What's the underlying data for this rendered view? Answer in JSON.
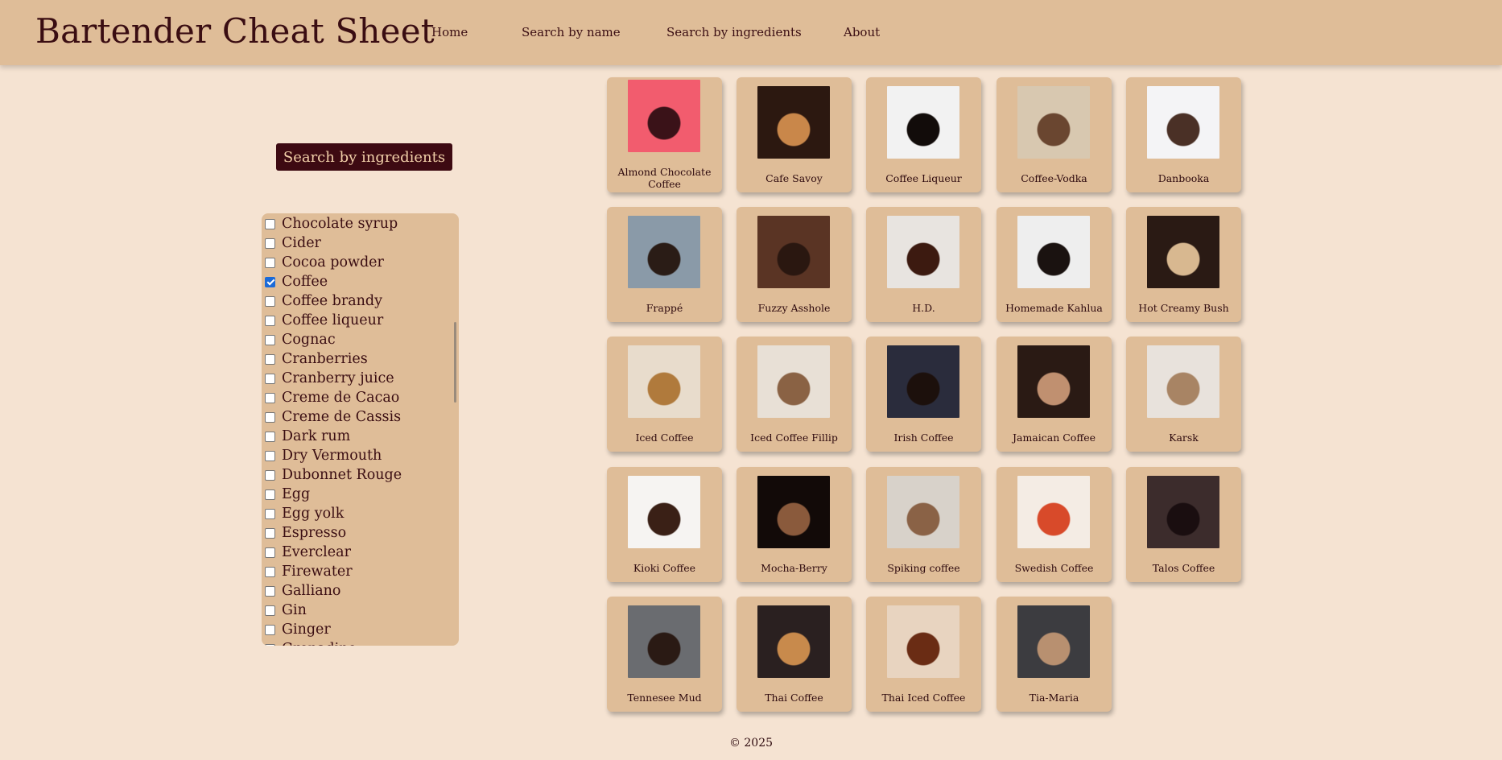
{
  "header": {
    "title": "Bartender Cheat Sheet",
    "nav": [
      "Home",
      "Search by name",
      "Search by ingredients",
      "About"
    ]
  },
  "search": {
    "button_label": "Search by ingredients"
  },
  "ingredients": [
    {
      "label": "Chocolate syrup",
      "checked": false
    },
    {
      "label": "Cider",
      "checked": false
    },
    {
      "label": "Cocoa powder",
      "checked": false
    },
    {
      "label": "Coffee",
      "checked": true
    },
    {
      "label": "Coffee brandy",
      "checked": false
    },
    {
      "label": "Coffee liqueur",
      "checked": false
    },
    {
      "label": "Cognac",
      "checked": false
    },
    {
      "label": "Cranberries",
      "checked": false
    },
    {
      "label": "Cranberry juice",
      "checked": false
    },
    {
      "label": "Creme de Cacao",
      "checked": false
    },
    {
      "label": "Creme de Cassis",
      "checked": false
    },
    {
      "label": "Dark rum",
      "checked": false
    },
    {
      "label": "Dry Vermouth",
      "checked": false
    },
    {
      "label": "Dubonnet Rouge",
      "checked": false
    },
    {
      "label": "Egg",
      "checked": false
    },
    {
      "label": "Egg yolk",
      "checked": false
    },
    {
      "label": "Espresso",
      "checked": false
    },
    {
      "label": "Everclear",
      "checked": false
    },
    {
      "label": "Firewater",
      "checked": false
    },
    {
      "label": "Galliano",
      "checked": false
    },
    {
      "label": "Gin",
      "checked": false
    },
    {
      "label": "Ginger",
      "checked": false
    },
    {
      "label": "Grenadine",
      "checked": false
    }
  ],
  "drinks": [
    {
      "name": "Almond Chocolate Coffee",
      "colors": [
        "#f25c6e",
        "#3a1218"
      ]
    },
    {
      "name": "Cafe Savoy",
      "colors": [
        "#2c1810",
        "#c9874a"
      ]
    },
    {
      "name": "Coffee Liqueur",
      "colors": [
        "#f2f2f2",
        "#120c0a"
      ]
    },
    {
      "name": "Coffee-Vodka",
      "colors": [
        "#d8c8b0",
        "#6a4630"
      ]
    },
    {
      "name": "Danbooka",
      "colors": [
        "#f4f4f6",
        "#4a3026"
      ]
    },
    {
      "name": "Frappé",
      "colors": [
        "#8a9aa8",
        "#2a1c16"
      ]
    },
    {
      "name": "Fuzzy Asshole",
      "colors": [
        "#5a3424",
        "#2a1710"
      ]
    },
    {
      "name": "H.D.",
      "colors": [
        "#e8e4e0",
        "#3c1a10"
      ]
    },
    {
      "name": "Homemade Kahlua",
      "colors": [
        "#eeeeee",
        "#1a1210"
      ]
    },
    {
      "name": "Hot Creamy Bush",
      "colors": [
        "#2a1a14",
        "#d8b890"
      ]
    },
    {
      "name": "Iced Coffee",
      "colors": [
        "#e8dccc",
        "#b07a3c"
      ]
    },
    {
      "name": "Iced Coffee Fillip",
      "colors": [
        "#e8e0d6",
        "#8a6244"
      ]
    },
    {
      "name": "Irish Coffee",
      "colors": [
        "#2a2c3c",
        "#1c100c"
      ]
    },
    {
      "name": "Jamaican Coffee",
      "colors": [
        "#2a1a14",
        "#c09070"
      ]
    },
    {
      "name": "Karsk",
      "colors": [
        "#e8e2dc",
        "#a88464"
      ]
    },
    {
      "name": "Kioki Coffee",
      "colors": [
        "#f6f4f2",
        "#3a2016"
      ]
    },
    {
      "name": "Mocha-Berry",
      "colors": [
        "#120a08",
        "#8a5a3c"
      ]
    },
    {
      "name": "Spiking coffee",
      "colors": [
        "#d8d2ca",
        "#8a6246"
      ]
    },
    {
      "name": "Swedish Coffee",
      "colors": [
        "#f4ece4",
        "#d84a2a"
      ]
    },
    {
      "name": "Talos Coffee",
      "colors": [
        "#3c2c2c",
        "#1a0e10"
      ]
    },
    {
      "name": "Tennesee Mud",
      "colors": [
        "#6a6c70",
        "#2a1a14"
      ]
    },
    {
      "name": "Thai Coffee",
      "colors": [
        "#2a2020",
        "#c88a4c"
      ]
    },
    {
      "name": "Thai Iced Coffee",
      "colors": [
        "#e8d4c0",
        "#6a2c14"
      ]
    },
    {
      "name": "Tia-Maria",
      "colors": [
        "#3c3c40",
        "#b89070"
      ]
    }
  ],
  "footer": {
    "copyright": "© 2025"
  }
}
